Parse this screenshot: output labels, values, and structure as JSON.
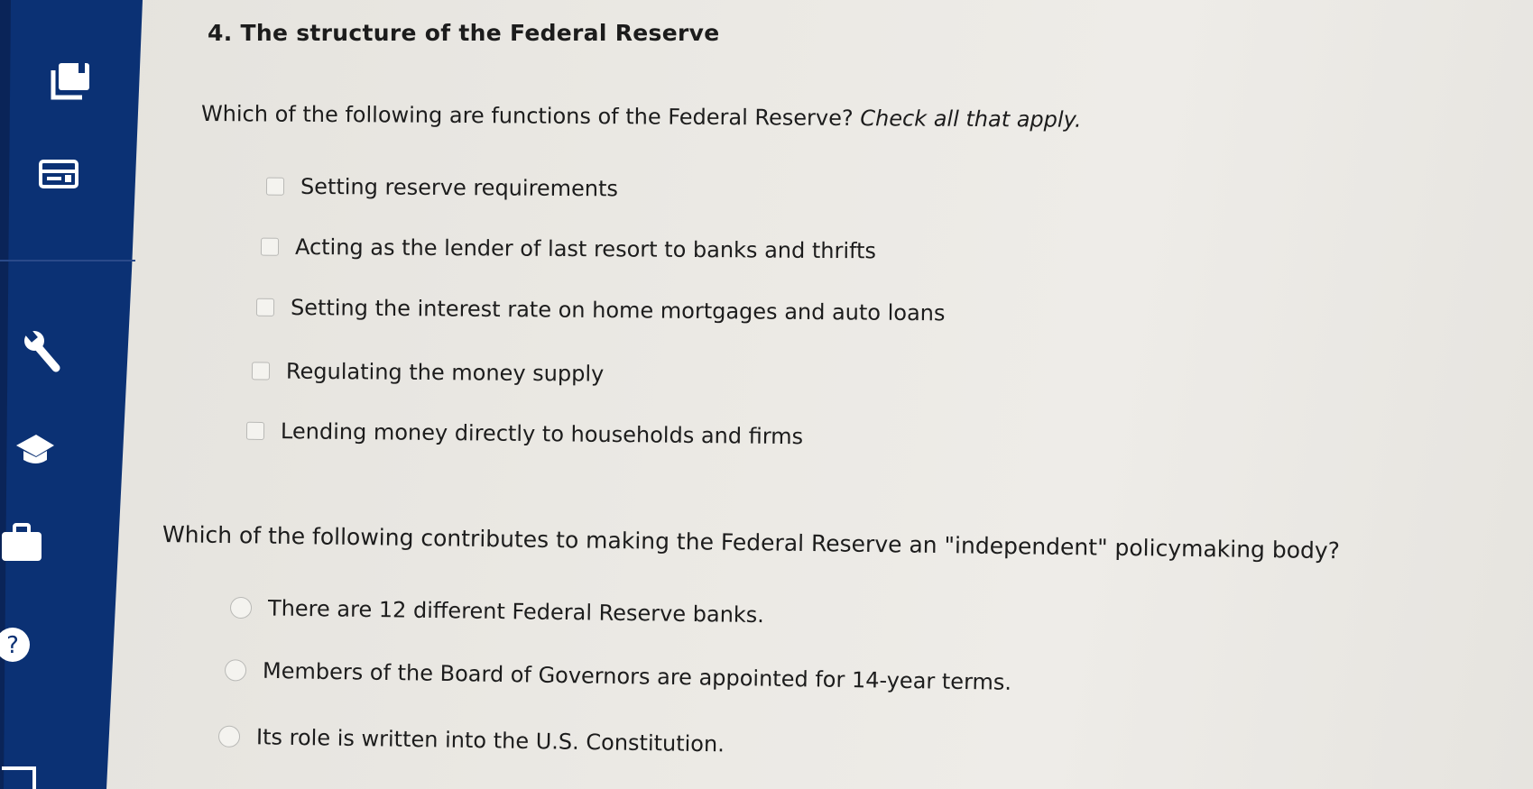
{
  "question": {
    "title": "4. The structure of the Federal Reserve"
  },
  "q1": {
    "prompt": "Which of the following are functions of the Federal Reserve?",
    "hint": "Check all that apply.",
    "options": [
      "Setting reserve requirements",
      "Acting as the lender of last resort to banks and thrifts",
      "Setting the interest rate on home mortgages and auto loans",
      "Regulating the money supply",
      "Lending money directly to households and firms"
    ]
  },
  "q2": {
    "prompt": "Which of the following contributes to making the Federal Reserve an \"independent\" policymaking body?",
    "options": [
      "There are 12 different Federal Reserve banks.",
      "Members of the Board of Governors are appointed for 14-year terms.",
      "Its role is written into the U.S. Constitution."
    ]
  },
  "sidebar": {
    "icons": [
      "ebook-icon",
      "calendar-icon",
      "tools-icon",
      "graduation-cap-icon",
      "briefcase-icon",
      "help-icon"
    ],
    "help_label": "?"
  },
  "colors": {
    "sidebar": "#0b3174",
    "page": "#e9e7e2",
    "text": "#1c1c1c",
    "control_border": "#b9b9b6"
  }
}
